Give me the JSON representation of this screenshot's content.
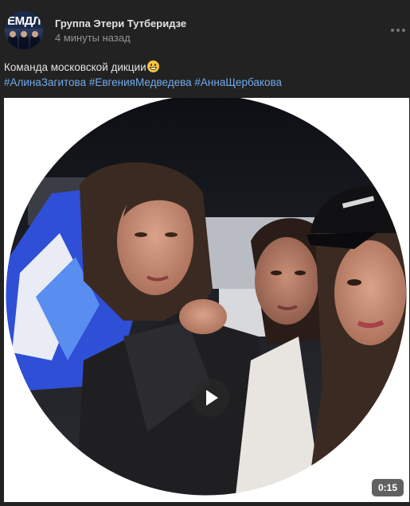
{
  "post": {
    "group_name": "Группа Этери Тутберидзе",
    "time": "4 минуты назад",
    "text": "Команда московской дикции",
    "emoji": "grinning-face-emoji",
    "hashtags": [
      "#АлинаЗагитова",
      "#ЕвгенияМедведева",
      "#АннаЩербакова"
    ]
  },
  "avatar": {
    "logo_text": "ЕМДЛ"
  },
  "video": {
    "duration": "0:15",
    "play_icon": "play-icon",
    "more_icon": "more-dots-icon"
  },
  "colors": {
    "background": "#222222",
    "link": "#71aaeb",
    "text": "#e1e3e6",
    "muted": "#939393"
  }
}
